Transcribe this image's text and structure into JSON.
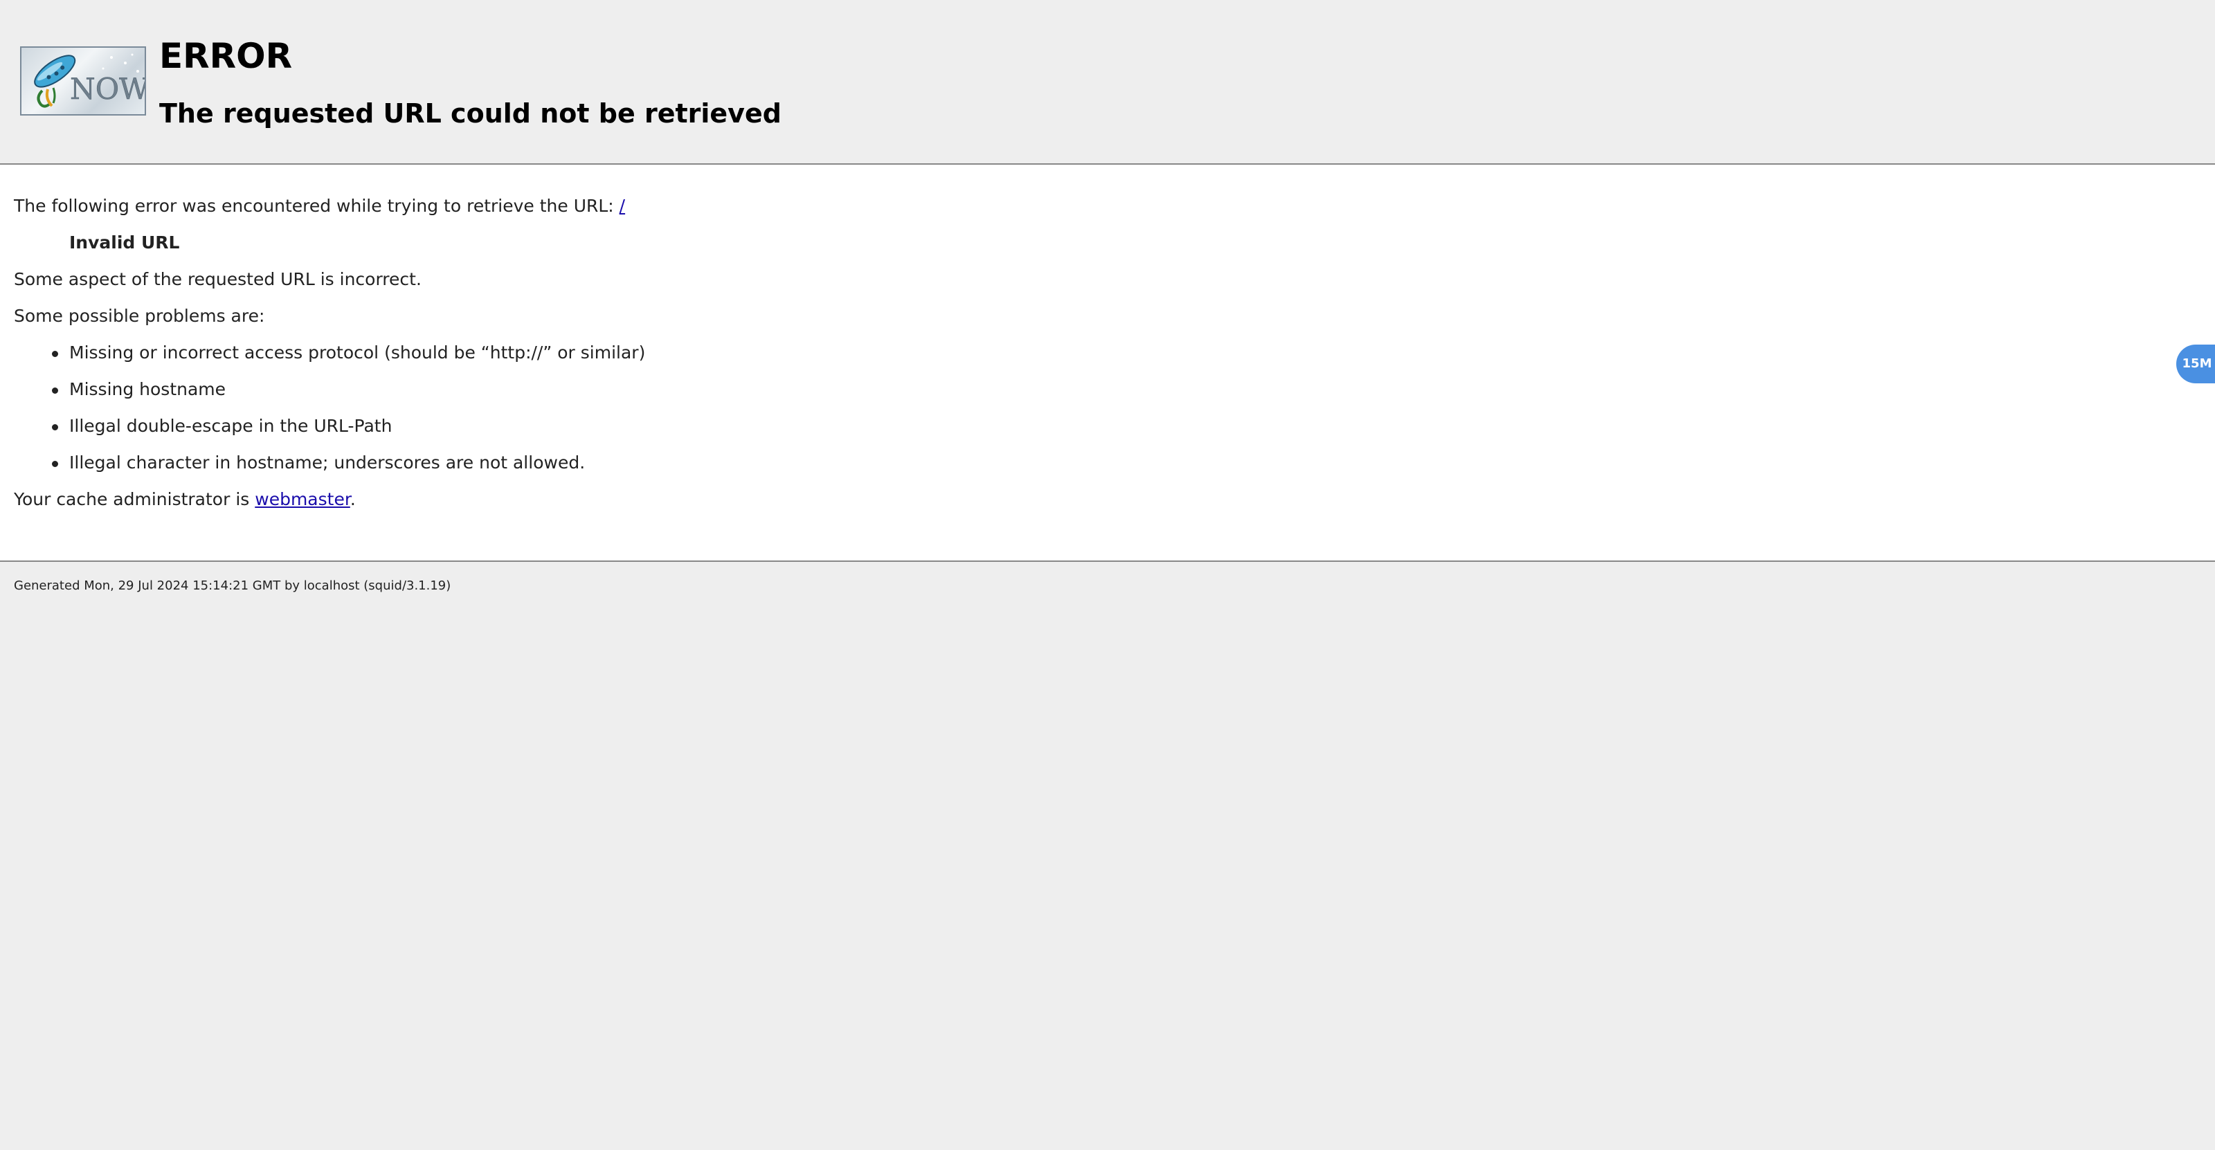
{
  "titles": {
    "heading": "ERROR",
    "subheading": "The requested URL could not be retrieved",
    "logo_text": "NOW"
  },
  "content": {
    "intro_text": "The following error was encountered while trying to retrieve the URL: ",
    "url_link": "/",
    "error_name": "Invalid URL",
    "description": "Some aspect of the requested URL is incorrect.",
    "problems_intro": "Some possible problems are:",
    "problems": [
      "Missing or incorrect access protocol (should be “http://” or similar)",
      "Missing hostname",
      "Illegal double-escape in the URL-Path",
      "Illegal character in hostname; underscores are not allowed."
    ],
    "admin_prefix": "Your cache administrator is ",
    "admin_link": "webmaster",
    "admin_suffix": "."
  },
  "footer": {
    "generated": "Generated Mon, 29 Jul 2024 15:14:21 GMT by localhost (squid/3.1.19)"
  },
  "side_badge": {
    "label": "15M"
  },
  "colors": {
    "page_bg": "#eeeeee",
    "content_bg": "#ffffff",
    "link": "#1a0dab",
    "badge": "#4a90e2"
  },
  "icons": {
    "logo": "squid-logo-icon"
  }
}
